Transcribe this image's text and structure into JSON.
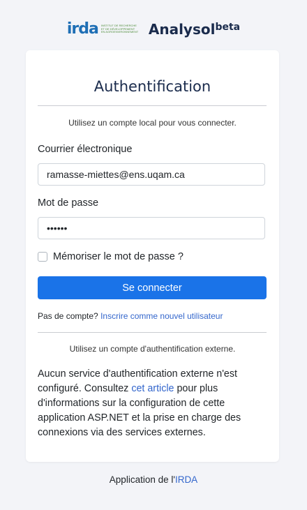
{
  "header": {
    "logo_text": "irda",
    "logo_tagline": [
      "Institut de recherche",
      "et de développement",
      "en agroenvironnement"
    ],
    "brand": "Analysol",
    "brand_sup": "beta"
  },
  "login": {
    "title": "Authentification",
    "local_subtitle": "Utilisez un compte local pour vous connecter.",
    "email_label": "Courrier électronique",
    "email_value": "ramasse-miettes@ens.uqam.ca",
    "password_label": "Mot de passe",
    "password_value": "••••••",
    "remember_label": "Mémoriser le mot de passe ?",
    "submit_label": "Se connecter",
    "no_account_text": "Pas de compte? ",
    "register_link": "Inscrire comme nouvel utilisateur"
  },
  "external": {
    "subtitle": "Utilisez un compte d'authentification externe.",
    "text_before": "Aucun service d'authentification externe n'est configuré. Consultez ",
    "article_link": "cet article",
    "text_after": " pour plus d'informations sur la configuration de cette application ASP.NET et la prise en charge des connexions via des services externes."
  },
  "footer": {
    "prefix": "Application de l'",
    "link": "IRDA"
  },
  "colors": {
    "primary": "#1a73e8",
    "link": "#3366cc",
    "title": "#1a2b4c",
    "background": "#f3f4f8"
  }
}
